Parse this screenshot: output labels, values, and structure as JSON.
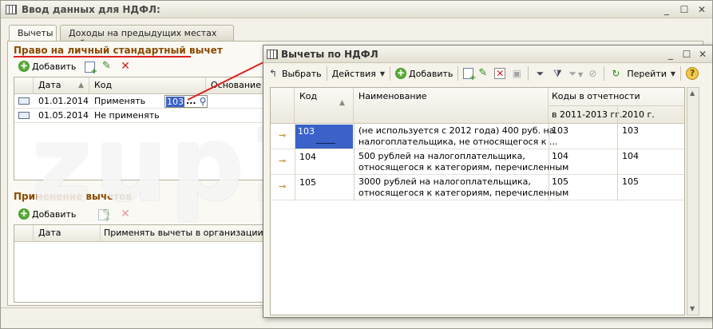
{
  "main": {
    "title": "Ввод данных для НДФЛ:",
    "tabs": [
      {
        "label": "Вычеты",
        "active": true
      },
      {
        "label": "Доходы на предыдущих местах работы",
        "active": false
      }
    ]
  },
  "section1": {
    "title": "Право на личный стандартный вычет",
    "add_label": "Добавить",
    "columns": [
      "Дата",
      "Код",
      "Основание"
    ],
    "rows": [
      {
        "date": "01.01.2014",
        "code": "Применять",
        "value": "103",
        "ellipsis": "..."
      },
      {
        "date": "01.05.2014",
        "code": "Не применять",
        "value": "",
        "ellipsis": ""
      }
    ]
  },
  "section2": {
    "title": "Применение вычетов",
    "add_label": "Добавить",
    "columns": [
      "Дата",
      "Применять вычеты в организации"
    ]
  },
  "watermark": "zup1c.ru",
  "dialog": {
    "title": "Вычеты по НДФЛ",
    "toolbar": {
      "select_label": "Выбрать",
      "actions_label": "Действия",
      "add_label": "Добавить",
      "goto_label": "Перейти"
    },
    "columns": {
      "code": "Код",
      "name": "Наименование",
      "report_codes": "Коды в отчетности",
      "period1": "в 2011-2013 гг.",
      "period2": "2010 г."
    },
    "rows": [
      {
        "code": "103",
        "name_line1": "(не используется с 2012 года) 400 руб. на",
        "name_line2": "налогоплательщика, не относящегося к ...",
        "c1": "103",
        "c2": "103"
      },
      {
        "code": "104",
        "name_line1": "500 рублей на налогоплательщика,",
        "name_line2": "относящегося к категориям, перечисленным",
        "c1": "104",
        "c2": "104"
      },
      {
        "code": "105",
        "name_line1": "3000 рублей на налогоплательщика,",
        "name_line2": "относящегося к категориям, перечисленным",
        "c1": "105",
        "c2": "105"
      }
    ]
  },
  "colors": {
    "section_title": "#8b4a00",
    "selection": "#3a62c8",
    "red_underline": "#e02020"
  }
}
